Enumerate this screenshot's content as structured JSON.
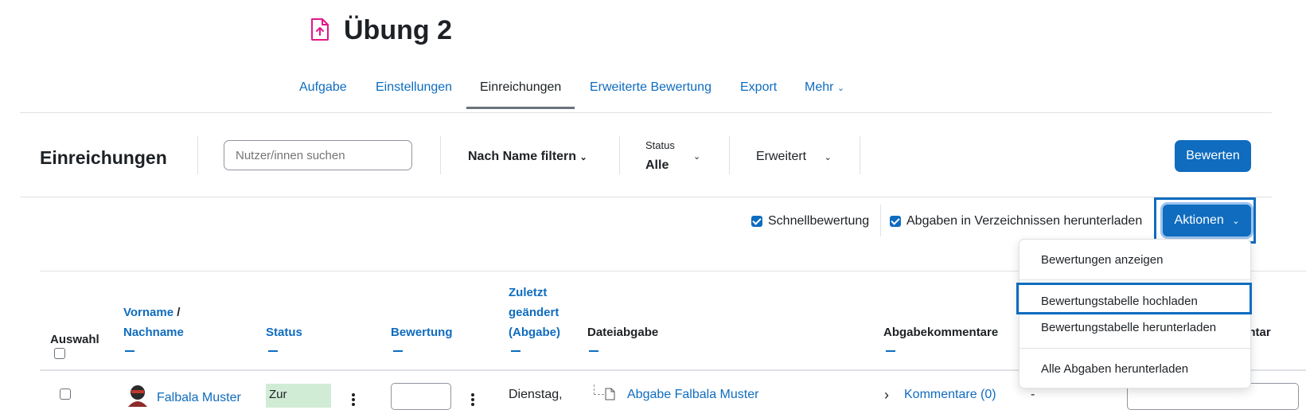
{
  "page": {
    "title": "Übung 2",
    "title_icon": "assignment-upload-icon"
  },
  "nav": {
    "tabs": [
      {
        "label": "Aufgabe",
        "active": false
      },
      {
        "label": "Einstellungen",
        "active": false
      },
      {
        "label": "Einreichungen",
        "active": true
      },
      {
        "label": "Erweiterte Bewertung",
        "active": false
      },
      {
        "label": "Export",
        "active": false
      },
      {
        "label": "Mehr",
        "active": false
      }
    ]
  },
  "toolbar": {
    "heading": "Einreichungen",
    "search_placeholder": "Nutzer/innen suchen",
    "filter_name": "Nach Name filtern",
    "status_label": "Status",
    "status_value": "Alle",
    "advanced": "Erweitert",
    "grade_button": "Bewerten"
  },
  "options": {
    "quick_grading": {
      "label": "Schnellbewertung",
      "checked": true
    },
    "download_folders": {
      "label": "Abgaben in Verzeichnissen herunterladen",
      "checked": true
    },
    "actions_button": "Aktionen"
  },
  "table": {
    "headers": {
      "select": "Auswahl",
      "name_first": "Vorname",
      "name_sep": " /",
      "name_last": "Nachname",
      "status": "Status",
      "grade": "Bewertung",
      "modified_1": "Zuletzt",
      "modified_2": "geändert",
      "modified_3": "(Abgabe)",
      "file": "Dateiabgabe",
      "comments": "Abgabekommentare",
      "feedback_partial": "entar"
    },
    "rows": [
      {
        "name": "Falbala Muster",
        "status": "Zur",
        "modified": "Dienstag,",
        "file": "Abgabe Falbala Muster",
        "comments": "Kommentare (0)",
        "extra": "-"
      }
    ]
  },
  "actions_menu": {
    "items": [
      "Bewertungen anzeigen",
      "Bewertungstabelle hochladen",
      "Bewertungstabelle herunterladen",
      "Alle Abgaben herunterladen"
    ],
    "highlighted_index": 1
  },
  "colors": {
    "accent": "#0f6cbf",
    "status_bg": "#d1ecd5",
    "title_icon": "#e3178a"
  }
}
